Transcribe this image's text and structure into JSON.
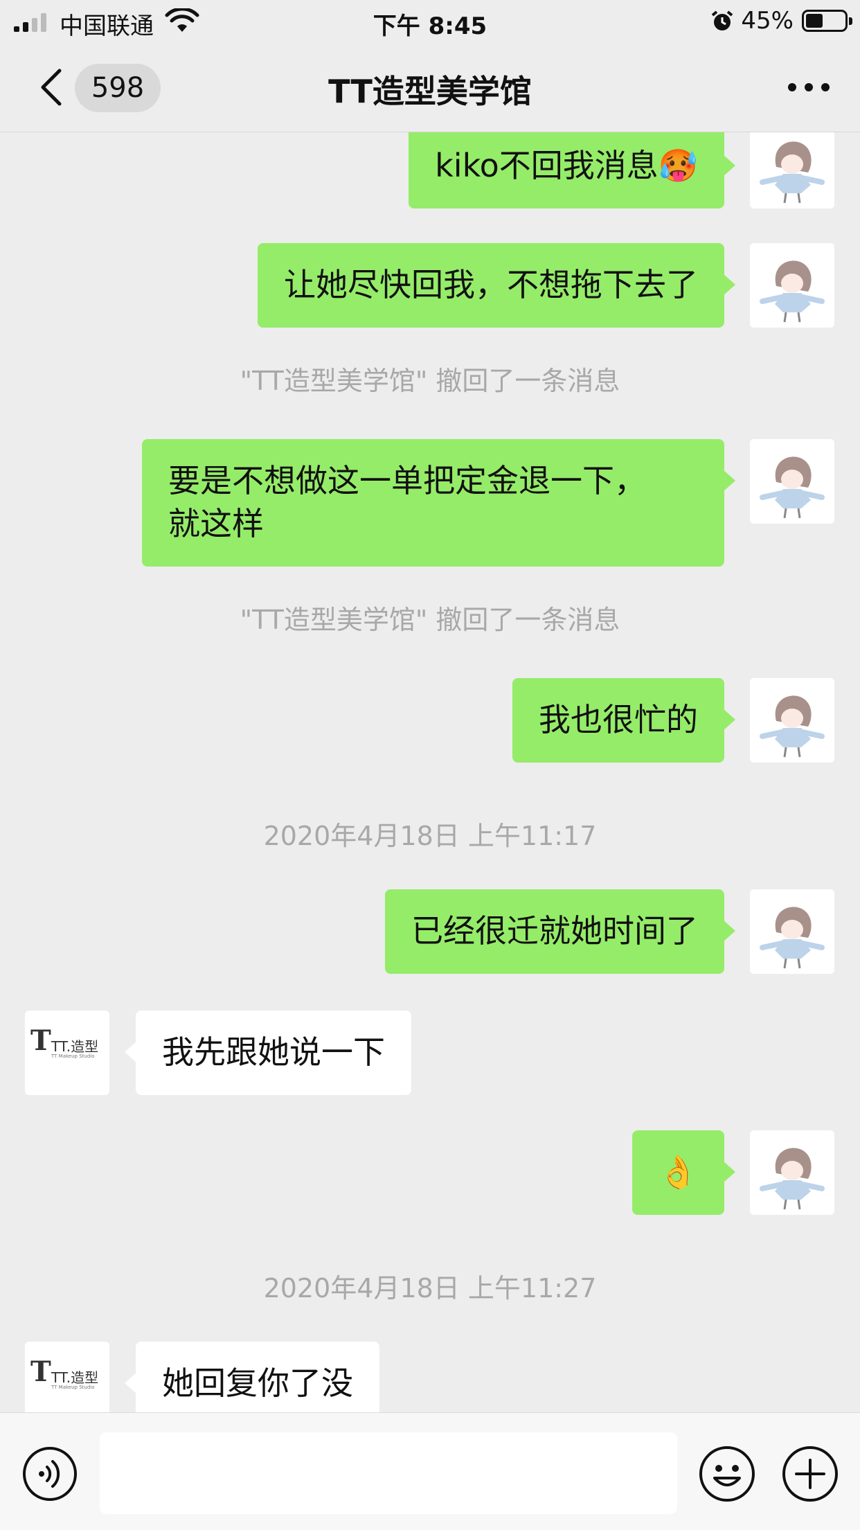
{
  "status_bar": {
    "carrier": "中国联通",
    "time": "下午 8:45",
    "battery": "45%"
  },
  "nav": {
    "unread_count": "598",
    "title": "TT造型美学馆"
  },
  "messages": [
    {
      "type": "me",
      "text": "kiko不回我消息🥵"
    },
    {
      "type": "me",
      "text": "让她尽快回我，不想拖下去了"
    },
    {
      "type": "system",
      "text": "\"TT造型美学馆\" 撤回了一条消息"
    },
    {
      "type": "me",
      "text": "要是不想做这一单把定金退一下，\n就这样"
    },
    {
      "type": "system",
      "text": "\"TT造型美学馆\" 撤回了一条消息"
    },
    {
      "type": "me",
      "text": "我也很忙的"
    },
    {
      "type": "time",
      "text": "2020年4月18日 上午11:17"
    },
    {
      "type": "me",
      "text": "已经很迁就她时间了"
    },
    {
      "type": "them",
      "text": "我先跟她说一下"
    },
    {
      "type": "me",
      "text": "👌"
    },
    {
      "type": "time",
      "text": "2020年4月18日 上午11:27"
    },
    {
      "type": "them",
      "text": "她回复你了没"
    }
  ],
  "contact_avatar": {
    "logo_text": "TT.造型",
    "logo_subtext": "TT Makeup Studio"
  },
  "colors": {
    "my_bubble": "#95ec69",
    "their_bubble": "#ffffff",
    "background": "#ededed"
  },
  "icons": [
    "signal-icon",
    "wifi-icon",
    "alarm-icon",
    "battery-icon",
    "back-chevron-icon",
    "more-icon",
    "voice-icon",
    "emoji-icon",
    "plus-icon"
  ]
}
